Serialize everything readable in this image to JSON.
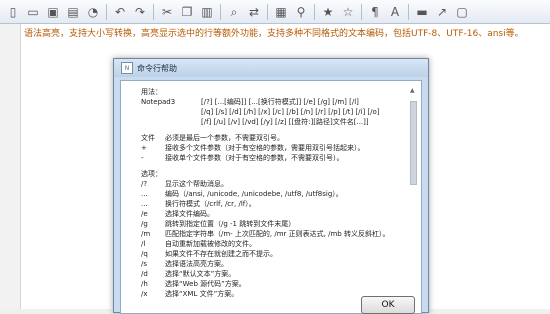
{
  "toolbar": {
    "icons": [
      {
        "name": "new-file-icon",
        "glyph": "▯"
      },
      {
        "name": "open-file-icon",
        "glyph": "▭"
      },
      {
        "name": "save-icon",
        "glyph": "▣"
      },
      {
        "name": "save-all-icon",
        "glyph": "▤"
      },
      {
        "name": "close-file-icon",
        "glyph": "◔"
      },
      {
        "name": "undo-icon",
        "glyph": "↶"
      },
      {
        "name": "redo-icon",
        "glyph": "↷"
      },
      {
        "name": "cut-icon",
        "glyph": "✂"
      },
      {
        "name": "copy-icon",
        "glyph": "❐"
      },
      {
        "name": "paste-icon",
        "glyph": "▥"
      },
      {
        "name": "find-icon",
        "glyph": "⌕"
      },
      {
        "name": "replace-icon",
        "glyph": "⇄"
      },
      {
        "name": "print-preview-icon",
        "glyph": "▦"
      },
      {
        "name": "zoom-icon",
        "glyph": "⚲"
      },
      {
        "name": "bookmark-icon",
        "glyph": "★"
      },
      {
        "name": "bookmark-next-icon",
        "glyph": "☆"
      },
      {
        "name": "word-wrap-icon",
        "glyph": "¶"
      },
      {
        "name": "encoding-icon",
        "glyph": "A"
      },
      {
        "name": "terminal-icon",
        "glyph": "▬"
      },
      {
        "name": "pin-icon",
        "glyph": "↗"
      },
      {
        "name": "window-icon",
        "glyph": "▢"
      }
    ]
  },
  "editor": {
    "line1": "语法高亮，支持大小写转换，高亮显示选中的行等额外功能，支持多种不同格式的文本编码，包括UTF-8、UTF-16、ansi等。"
  },
  "dialog": {
    "title": "命令行帮助",
    "ok_label": "OK",
    "usage_label": "用法：",
    "usage_cmd": "Notepad3",
    "usage_lines": [
      "[/?] [...[编码]] [...[换行符模式]] [/e] [/g] [/m] [/l]",
      "[/q] [/s] [/d] [/h] [/x] [/c] [/b] [/n] [/r] [/p] [/t] [/i] [/o]",
      "[/f] [/u] [/v] [/vd] [/y] [/z] [[盘符:][路径]文件名[...]]"
    ],
    "args": [
      {
        "k": "文件",
        "v": "必须是最后一个参数，不需要双引号。"
      },
      {
        "k": "+",
        "v": "接收多个文件参数（对于有空格的参数，需要用双引号括起来）。"
      },
      {
        "k": "-",
        "v": "接收单个文件参数（对于有空格的参数，不需要双引号）。"
      }
    ],
    "options_label": "选项：",
    "options": [
      {
        "k": "/?",
        "v": "显示这个帮助消息。"
      },
      {
        "k": "...",
        "v": "编码（/ansi, /unicode, /unicodebe, /utf8, /utf8sig）。"
      },
      {
        "k": "...",
        "v": "换行符模式（/crlf, /cr, /lf）。"
      },
      {
        "k": "/e",
        "v": "选择文件编码。"
      },
      {
        "k": "/g",
        "v": "跳转到指定位置（/g -1 跳转到文件末尾）"
      },
      {
        "k": "/m",
        "v": "匹配指定字符串（/m- 上次匹配的, /mr 正则表达式, /mb 转义反斜杠）。"
      },
      {
        "k": "/l",
        "v": "自动重新加载被修改的文件。"
      },
      {
        "k": "/q",
        "v": "如果文件不存在就创建之而不提示。"
      },
      {
        "k": "/s",
        "v": "选择语法高亮方案。"
      },
      {
        "k": "/d",
        "v": "选择“默认文本”方案。"
      },
      {
        "k": "/h",
        "v": "选择“Web 源代码”方案。"
      },
      {
        "k": "/x",
        "v": "选择“XML 文件”方案。"
      }
    ]
  }
}
